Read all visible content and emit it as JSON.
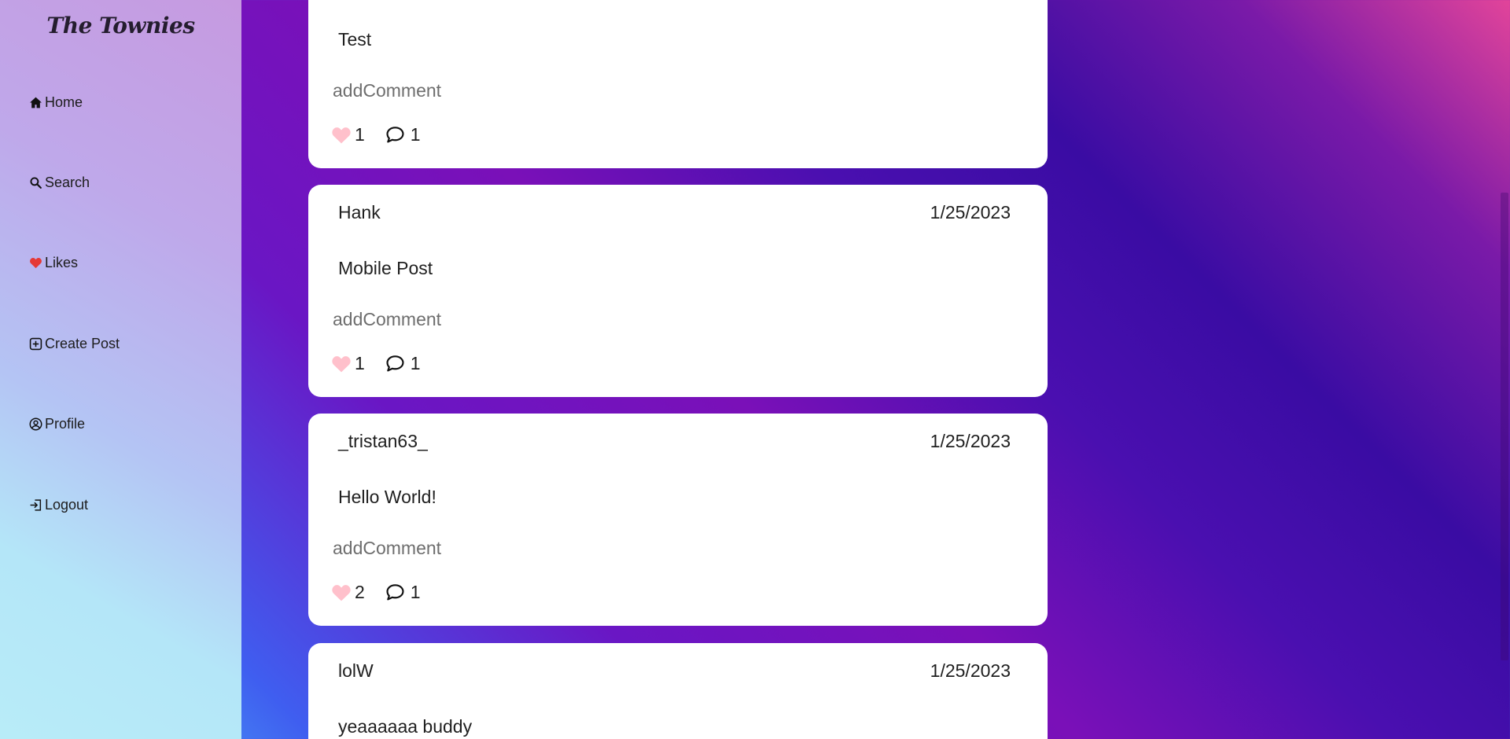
{
  "app": {
    "logo": "The Townies"
  },
  "sidebar": {
    "items": [
      {
        "label": "Home",
        "icon": "home-icon"
      },
      {
        "label": "Search",
        "icon": "search-icon"
      },
      {
        "label": "Likes",
        "icon": "heart-icon"
      },
      {
        "label": "Create Post",
        "icon": "plus-square-icon"
      },
      {
        "label": "Profile",
        "icon": "user-circle-icon"
      },
      {
        "label": "Logout",
        "icon": "logout-icon"
      }
    ]
  },
  "colors": {
    "like_heart": "#ffc0cb",
    "nav_heart": "#e53935"
  },
  "posts": [
    {
      "author": "",
      "date": "",
      "body": "Test",
      "comment_placeholder": "addComment",
      "likes": "1",
      "comments": "1"
    },
    {
      "author": "Hank",
      "date": "1/25/2023",
      "body": "Mobile Post",
      "comment_placeholder": "addComment",
      "likes": "1",
      "comments": "1"
    },
    {
      "author": "_tristan63_",
      "date": "1/25/2023",
      "body": "Hello World!",
      "comment_placeholder": "addComment",
      "likes": "2",
      "comments": "1"
    },
    {
      "author": "lolW",
      "date": "1/25/2023",
      "body": "yeaaaaaa buddy",
      "comment_placeholder": "addComment",
      "likes": "",
      "comments": ""
    }
  ]
}
